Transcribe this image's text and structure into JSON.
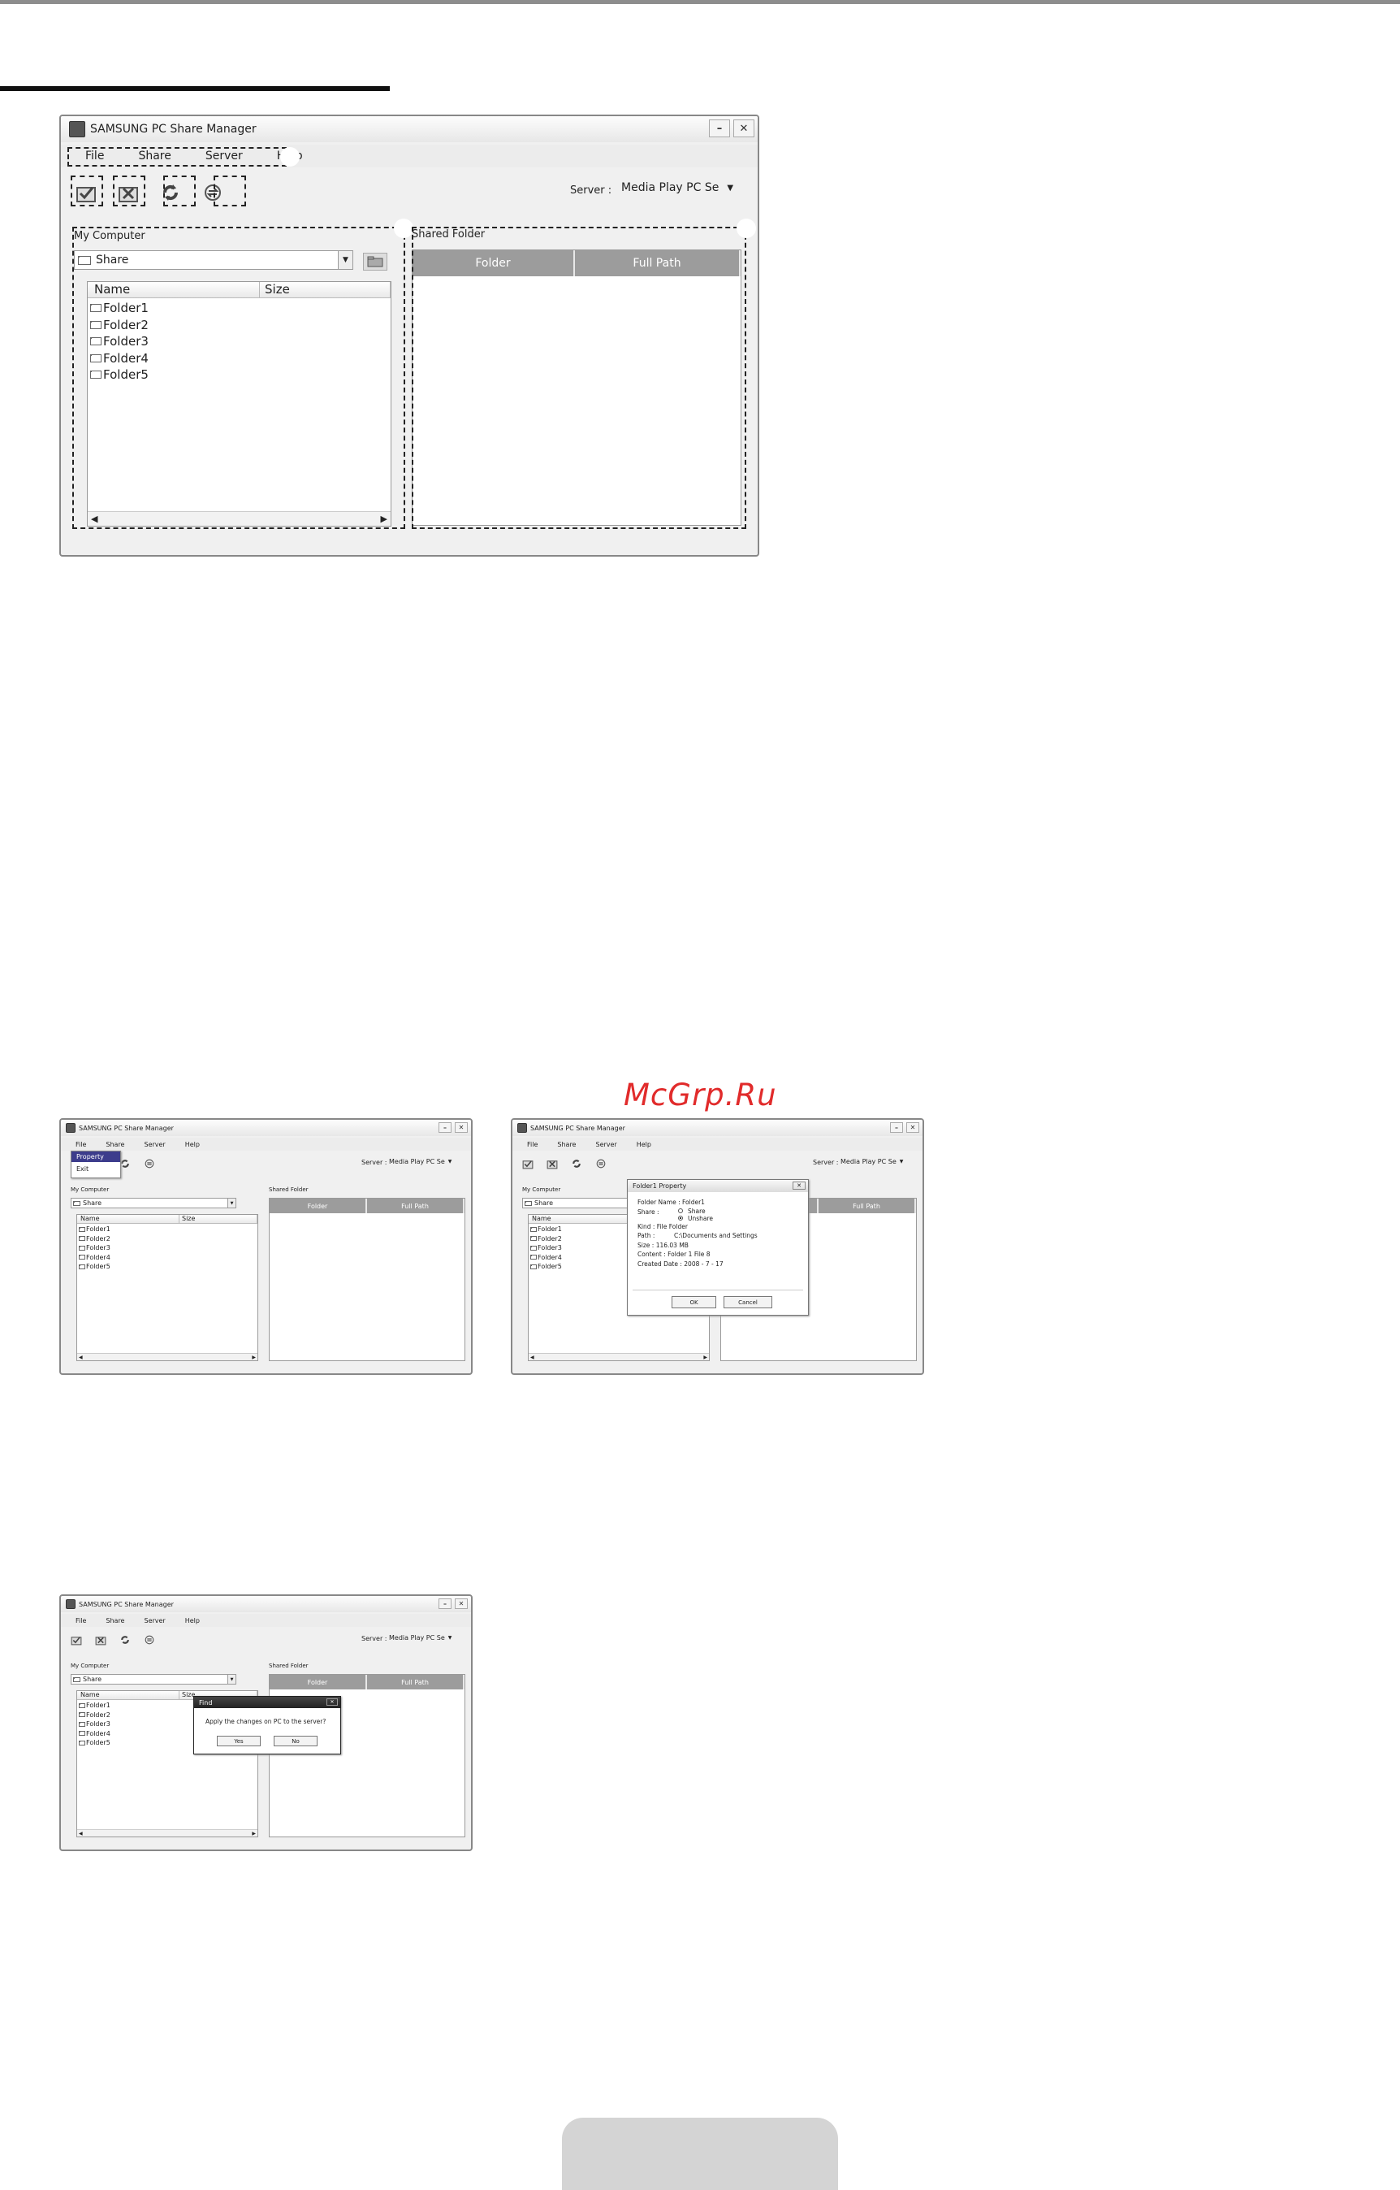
{
  "watermark": "McGrp.Ru",
  "app": {
    "title": "SAMSUNG PC Share Manager",
    "menu": [
      "File",
      "Share",
      "Server",
      "Help"
    ],
    "toolbar_icons": [
      "share-folder-icon",
      "unshare-folder-icon",
      "refresh-icon",
      "sync-icon"
    ],
    "server_label": "Server :",
    "server_value": "Media Play PC Se",
    "server_value_small": "Media Play PC Se",
    "my_computer_label": "My Computer",
    "combo_value": "Share",
    "columns": [
      "Name",
      "Size"
    ],
    "folders": [
      "Folder1",
      "Folder2",
      "Folder3",
      "Folder4",
      "Folder5"
    ],
    "shared_folder_label": "Shared Folder",
    "shared_columns": [
      "Folder",
      "Full Path"
    ]
  },
  "share_menu": {
    "items": [
      "Property",
      "Exit"
    ]
  },
  "property_dialog": {
    "title": "Folder1 Property",
    "folder_name": "Folder Name : Folder1",
    "share_label": "Share :",
    "options": [
      "Share",
      "Unshare"
    ],
    "kind": "Kind : File Folder",
    "path_label": "Path :",
    "path_value": "C:\\Documents and Settings",
    "size": "Size : 116.03 MB",
    "content": "Content : Folder 1 File 8",
    "created": "Created Date : 2008 - 7 - 17",
    "ok": "OK",
    "cancel": "Cancel"
  },
  "find_dialog": {
    "title": "Find",
    "message": "Apply the changes on PC to the server?",
    "yes": "Yes",
    "no": "No"
  }
}
